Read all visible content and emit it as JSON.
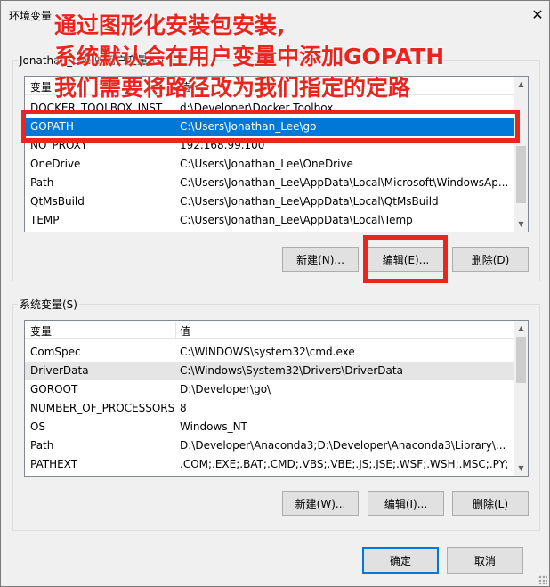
{
  "window": {
    "title": "环境变量",
    "close_glyph": "✕"
  },
  "user_vars": {
    "group_label": "Jonathan_Lee 的用户变量(U)",
    "header": {
      "name": "变量",
      "value": "值"
    },
    "rows": [
      {
        "name": "DOCKER_TOOLBOX_INST...",
        "value": "d:\\Developer\\Docker Toolbox"
      },
      {
        "name": "GOPATH",
        "value": "C:\\Users\\Jonathan_Lee\\go"
      },
      {
        "name": "NO_PROXY",
        "value": "192.168.99.100"
      },
      {
        "name": "OneDrive",
        "value": "C:\\Users\\Jonathan_Lee\\OneDrive"
      },
      {
        "name": "Path",
        "value": "C:\\Users\\Jonathan_Lee\\AppData\\Local\\Microsoft\\WindowsAp..."
      },
      {
        "name": "QtMsBuild",
        "value": "C:\\Users\\Jonathan_Lee\\AppData\\Local\\QtMsBuild"
      },
      {
        "name": "TEMP",
        "value": "C:\\Users\\Jonathan_Lee\\AppData\\Local\\Temp"
      }
    ],
    "buttons": {
      "new": "新建(N)...",
      "edit": "编辑(E)...",
      "delete": "删除(D)"
    }
  },
  "system_vars": {
    "group_label": "系统变量(S)",
    "header": {
      "name": "变量",
      "value": "值"
    },
    "rows": [
      {
        "name": "ComSpec",
        "value": "C:\\WINDOWS\\system32\\cmd.exe"
      },
      {
        "name": "DriverData",
        "value": "C:\\Windows\\System32\\Drivers\\DriverData"
      },
      {
        "name": "GOROOT",
        "value": "D:\\Developer\\go\\"
      },
      {
        "name": "NUMBER_OF_PROCESSORS",
        "value": "8"
      },
      {
        "name": "OS",
        "value": "Windows_NT"
      },
      {
        "name": "Path",
        "value": "D:\\Developer\\Anaconda3;D:\\Developer\\Anaconda3\\Library\\..."
      },
      {
        "name": "PATHEXT",
        "value": ".COM;.EXE;.BAT;.CMD;.VBS;.VBE;.JS;.JSE;.WSF;.WSH;.MSC;.PY;.P"
      }
    ],
    "buttons": {
      "new": "新建(W)...",
      "edit": "编辑(I)...",
      "delete": "删除(L)"
    }
  },
  "footer": {
    "ok": "确定",
    "cancel": "取消"
  },
  "annotation": {
    "line1": "通过图形化安装包安装,",
    "line2": "系统默认会在用户变量中添加GOPATH",
    "line3": "我们需要将路径改为我们指定的定路"
  },
  "colors": {
    "selection": "#0078d7",
    "annotation": "#e8251f",
    "hover_row": "#e5e5e5"
  }
}
